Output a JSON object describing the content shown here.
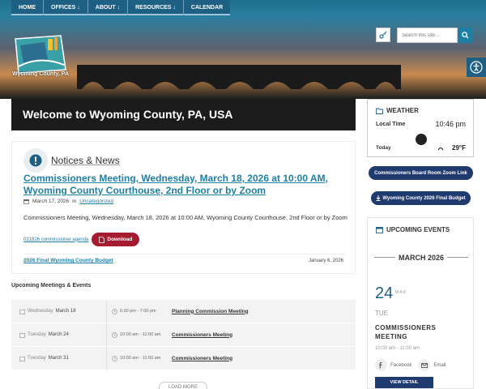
{
  "nav": {
    "items": [
      {
        "label": "HOME"
      },
      {
        "label": "OFFICES ↓"
      },
      {
        "label": "ABOUT ↓"
      },
      {
        "label": "RESOURCES ↓"
      },
      {
        "label": "CALENDAR"
      }
    ]
  },
  "brand": {
    "logo_text": "Wyoming County, PA"
  },
  "search": {
    "placeholder": "Search this site..."
  },
  "welcome": {
    "title": "Welcome to Wyoming County, PA, USA"
  },
  "news": {
    "section_title": "Notices & News",
    "headline": "Commissioners Meeting, Wednesday, March 18, 2026 at 10:00 AM, Wyoming County Courthouse, 2nd Floor or by Zoom",
    "date": "March 17, 2026",
    "in_label": "in",
    "category": "Uncategorized",
    "body": "Commissioners Meeting, Wednesday, March 18, 2026 at 10:00 AM, Wyoming County Courthouse, 2nd Floor or by Zoom",
    "attachment": "031826 commissioner agenda",
    "download_label": "Download",
    "item2_title": "2026 Final Wyoming County Budget",
    "item2_date": "January 6, 2026"
  },
  "events": {
    "section_title": "Upcoming Meetings & Events",
    "rows": [
      {
        "dow": "Wednesday",
        "date": "March 18",
        "time": "6:00 pm - 7:00 pm",
        "title": "Planning Commission Meeting"
      },
      {
        "dow": "Tuesday",
        "date": "March 24",
        "time": "10:00 am - 11:00 am",
        "title": "Commissioners Meeting"
      },
      {
        "dow": "Tuesday",
        "date": "March 31",
        "time": "10:00 am - 11:00 am",
        "title": "Commissioners Meeting"
      }
    ],
    "load_more": "LOAD MORE"
  },
  "weather": {
    "title": "WEATHER",
    "local_time_label": "Local Time",
    "local_time": "10:46 pm",
    "today_label": "Today",
    "temp": "29°F"
  },
  "links": {
    "zoom": "Commissioners Board Room Zoom Link",
    "budget": "Wyoming County 2026 Final Budget"
  },
  "upcoming": {
    "title": "UPCOMING EVENTS",
    "month": "MARCH 2026",
    "day": "24",
    "mon": "MAR",
    "dow": "TUE",
    "event_title": "COMMISSIONERS MEETING",
    "time": "10:00 am - 11:00 am",
    "facebook": "Facebook",
    "email": "Email",
    "view_detail": "VIEW DETAIL"
  },
  "colors": {
    "nav": "#1e5f84",
    "link": "#1f7fa3",
    "download": "#a51c30",
    "pill": "#1e3a6e"
  }
}
